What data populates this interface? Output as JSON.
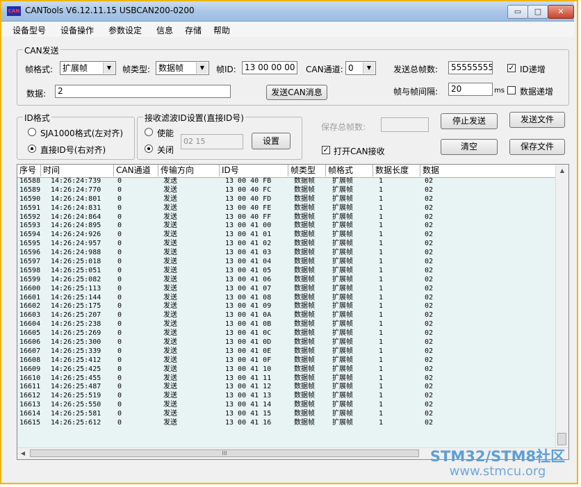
{
  "window": {
    "title": "CANTools V6.12.11.15  USBCAN200-0200",
    "icon_text": "CAN",
    "min_symbol": "▭",
    "max_symbol": "□",
    "close_symbol": "✕"
  },
  "menu": [
    "设备型号",
    "设备操作",
    "参数设定",
    "信息",
    "存储",
    "帮助"
  ],
  "can_send": {
    "group_title": "CAN发送",
    "frame_format_label": "帧格式:",
    "frame_format_value": "扩展帧",
    "frame_type_label": "帧类型:",
    "frame_type_value": "数据帧",
    "frame_id_label": "帧ID:",
    "frame_id_value": "13 00 00 00",
    "can_channel_label": "CAN通道:",
    "can_channel_value": "0",
    "total_frames_label": "发送总帧数:",
    "total_frames_value": "555555555",
    "id_increment_label": "ID递增",
    "id_increment_checked": true,
    "data_label": "数据:",
    "data_value": "2",
    "send_button": "发送CAN消息",
    "interval_label": "帧与帧间隔:",
    "interval_value": "20",
    "interval_unit": "ms",
    "data_increment_label": "数据递增",
    "data_increment_checked": false
  },
  "id_format": {
    "group_title": "ID格式",
    "option_sja": "SJA1000格式(左对齐)",
    "option_direct": "直接ID号(右对齐)",
    "selected": "direct"
  },
  "filter": {
    "group_title": "接收滤波ID设置(直接ID号)",
    "enable_label": "使能",
    "disable_label": "关闭",
    "selected": "disable",
    "id_value": "02 15",
    "set_button": "设置"
  },
  "save": {
    "total_label": "保存总帧数:",
    "total_value": "",
    "open_receive_label": "打开CAN接收",
    "open_receive_checked": true
  },
  "buttons": {
    "stop_send": "停止发送",
    "send_file": "发送文件",
    "clear": "清空",
    "save_file": "保存文件"
  },
  "table": {
    "columns": [
      "序号",
      "时间",
      "CAN通道",
      "传输方向",
      "ID号",
      "帧类型",
      "帧格式",
      "数据长度",
      "数据"
    ],
    "rows": [
      [
        "16588",
        "14:26:24:739",
        "0",
        "发送",
        "13 00 40 FB",
        "数据帧",
        "扩展帧",
        "1",
        "02"
      ],
      [
        "16589",
        "14:26:24:770",
        "0",
        "发送",
        "13 00 40 FC",
        "数据帧",
        "扩展帧",
        "1",
        "02"
      ],
      [
        "16590",
        "14:26:24:801",
        "0",
        "发送",
        "13 00 40 FD",
        "数据帧",
        "扩展帧",
        "1",
        "02"
      ],
      [
        "16591",
        "14:26:24:831",
        "0",
        "发送",
        "13 00 40 FE",
        "数据帧",
        "扩展帧",
        "1",
        "02"
      ],
      [
        "16592",
        "14:26:24:864",
        "0",
        "发送",
        "13 00 40 FF",
        "数据帧",
        "扩展帧",
        "1",
        "02"
      ],
      [
        "16593",
        "14:26:24:895",
        "0",
        "发送",
        "13 00 41 00",
        "数据帧",
        "扩展帧",
        "1",
        "02"
      ],
      [
        "16594",
        "14:26:24:926",
        "0",
        "发送",
        "13 00 41 01",
        "数据帧",
        "扩展帧",
        "1",
        "02"
      ],
      [
        "16595",
        "14:26:24:957",
        "0",
        "发送",
        "13 00 41 02",
        "数据帧",
        "扩展帧",
        "1",
        "02"
      ],
      [
        "16596",
        "14:26:24:988",
        "0",
        "发送",
        "13 00 41 03",
        "数据帧",
        "扩展帧",
        "1",
        "02"
      ],
      [
        "16597",
        "14:26:25:018",
        "0",
        "发送",
        "13 00 41 04",
        "数据帧",
        "扩展帧",
        "1",
        "02"
      ],
      [
        "16598",
        "14:26:25:051",
        "0",
        "发送",
        "13 00 41 05",
        "数据帧",
        "扩展帧",
        "1",
        "02"
      ],
      [
        "16599",
        "14:26:25:082",
        "0",
        "发送",
        "13 00 41 06",
        "数据帧",
        "扩展帧",
        "1",
        "02"
      ],
      [
        "16600",
        "14:26:25:113",
        "0",
        "发送",
        "13 00 41 07",
        "数据帧",
        "扩展帧",
        "1",
        "02"
      ],
      [
        "16601",
        "14:26:25:144",
        "0",
        "发送",
        "13 00 41 08",
        "数据帧",
        "扩展帧",
        "1",
        "02"
      ],
      [
        "16602",
        "14:26:25:175",
        "0",
        "发送",
        "13 00 41 09",
        "数据帧",
        "扩展帧",
        "1",
        "02"
      ],
      [
        "16603",
        "14:26:25:207",
        "0",
        "发送",
        "13 00 41 0A",
        "数据帧",
        "扩展帧",
        "1",
        "02"
      ],
      [
        "16604",
        "14:26:25:238",
        "0",
        "发送",
        "13 00 41 0B",
        "数据帧",
        "扩展帧",
        "1",
        "02"
      ],
      [
        "16605",
        "14:26:25:269",
        "0",
        "发送",
        "13 00 41 0C",
        "数据帧",
        "扩展帧",
        "1",
        "02"
      ],
      [
        "16606",
        "14:26:25:300",
        "0",
        "发送",
        "13 00 41 0D",
        "数据帧",
        "扩展帧",
        "1",
        "02"
      ],
      [
        "16607",
        "14:26:25:339",
        "0",
        "发送",
        "13 00 41 0E",
        "数据帧",
        "扩展帧",
        "1",
        "02"
      ],
      [
        "16608",
        "14:26:25:412",
        "0",
        "发送",
        "13 00 41 0F",
        "数据帧",
        "扩展帧",
        "1",
        "02"
      ],
      [
        "16609",
        "14:26:25:425",
        "0",
        "发送",
        "13 00 41 10",
        "数据帧",
        "扩展帧",
        "1",
        "02"
      ],
      [
        "16610",
        "14:26:25:455",
        "0",
        "发送",
        "13 00 41 11",
        "数据帧",
        "扩展帧",
        "1",
        "02"
      ],
      [
        "16611",
        "14:26:25:487",
        "0",
        "发送",
        "13 00 41 12",
        "数据帧",
        "扩展帧",
        "1",
        "02"
      ],
      [
        "16612",
        "14:26:25:519",
        "0",
        "发送",
        "13 00 41 13",
        "数据帧",
        "扩展帧",
        "1",
        "02"
      ],
      [
        "16613",
        "14:26:25:550",
        "0",
        "发送",
        "13 00 41 14",
        "数据帧",
        "扩展帧",
        "1",
        "02"
      ],
      [
        "16614",
        "14:26:25:581",
        "0",
        "发送",
        "13 00 41 15",
        "数据帧",
        "扩展帧",
        "1",
        "02"
      ],
      [
        "16615",
        "14:26:25:612",
        "0",
        "发送",
        "13 00 41 16",
        "数据帧",
        "扩展帧",
        "1",
        "02"
      ]
    ]
  },
  "scrollbar": {
    "up_arrow": "▲",
    "left_arrow": "◀",
    "thumb_grip": "III"
  },
  "watermark": {
    "line1": "STM32/STM8社区",
    "line2": "www.stmcu.org"
  }
}
